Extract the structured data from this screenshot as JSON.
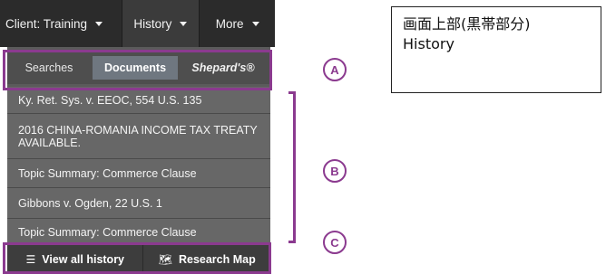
{
  "topbar": {
    "client_label": "Client: Training",
    "history_label": "History",
    "more_label": "More"
  },
  "tabs": {
    "searches": "Searches",
    "documents": "Documents",
    "shepards": "Shepard's®"
  },
  "history_items": [
    "Ky. Ret. Sys. v. EEOC, 554 U.S. 135",
    "2016 CHINA-ROMANIA INCOME TAX TREATY AVAILABLE.",
    "Topic Summary: Commerce Clause",
    "Gibbons v. Ogden, 22 U.S. 1",
    "Topic Summary: Commerce Clause"
  ],
  "footer": {
    "view_all_label": "View all history",
    "view_all_icon": "list-icon",
    "research_map_label": "Research Map",
    "research_map_icon": "map-icon"
  },
  "annotations": {
    "a": "A",
    "b": "B",
    "c": "C",
    "color": "#8b3a8f"
  },
  "note": {
    "line1": "画面上部(黒帯部分)",
    "line2": "History"
  }
}
